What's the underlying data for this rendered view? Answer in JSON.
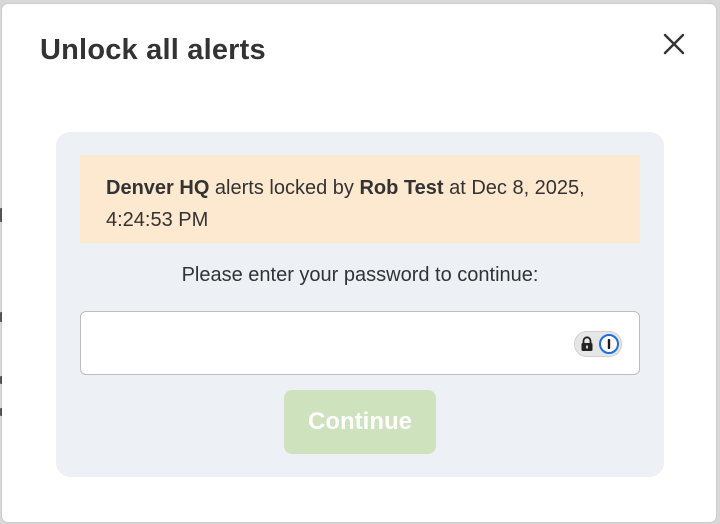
{
  "dialog": {
    "title": "Unlock all alerts",
    "close_icon": "close-icon"
  },
  "notice": {
    "location": "Denver HQ",
    "text_1": " alerts locked by ",
    "user": "Rob Test",
    "text_2": " at Dec 8, 2025, 4:24:53 PM",
    "background_color": "#fce9cf"
  },
  "prompt": {
    "text": "Please enter your password to continue:"
  },
  "password": {
    "value": "",
    "placeholder": "",
    "type": "password",
    "manager_icons": [
      "lock-icon",
      "password-manager-icon"
    ]
  },
  "actions": {
    "continue_label": "Continue",
    "continue_disabled": true,
    "continue_color": "#cde2bd"
  }
}
